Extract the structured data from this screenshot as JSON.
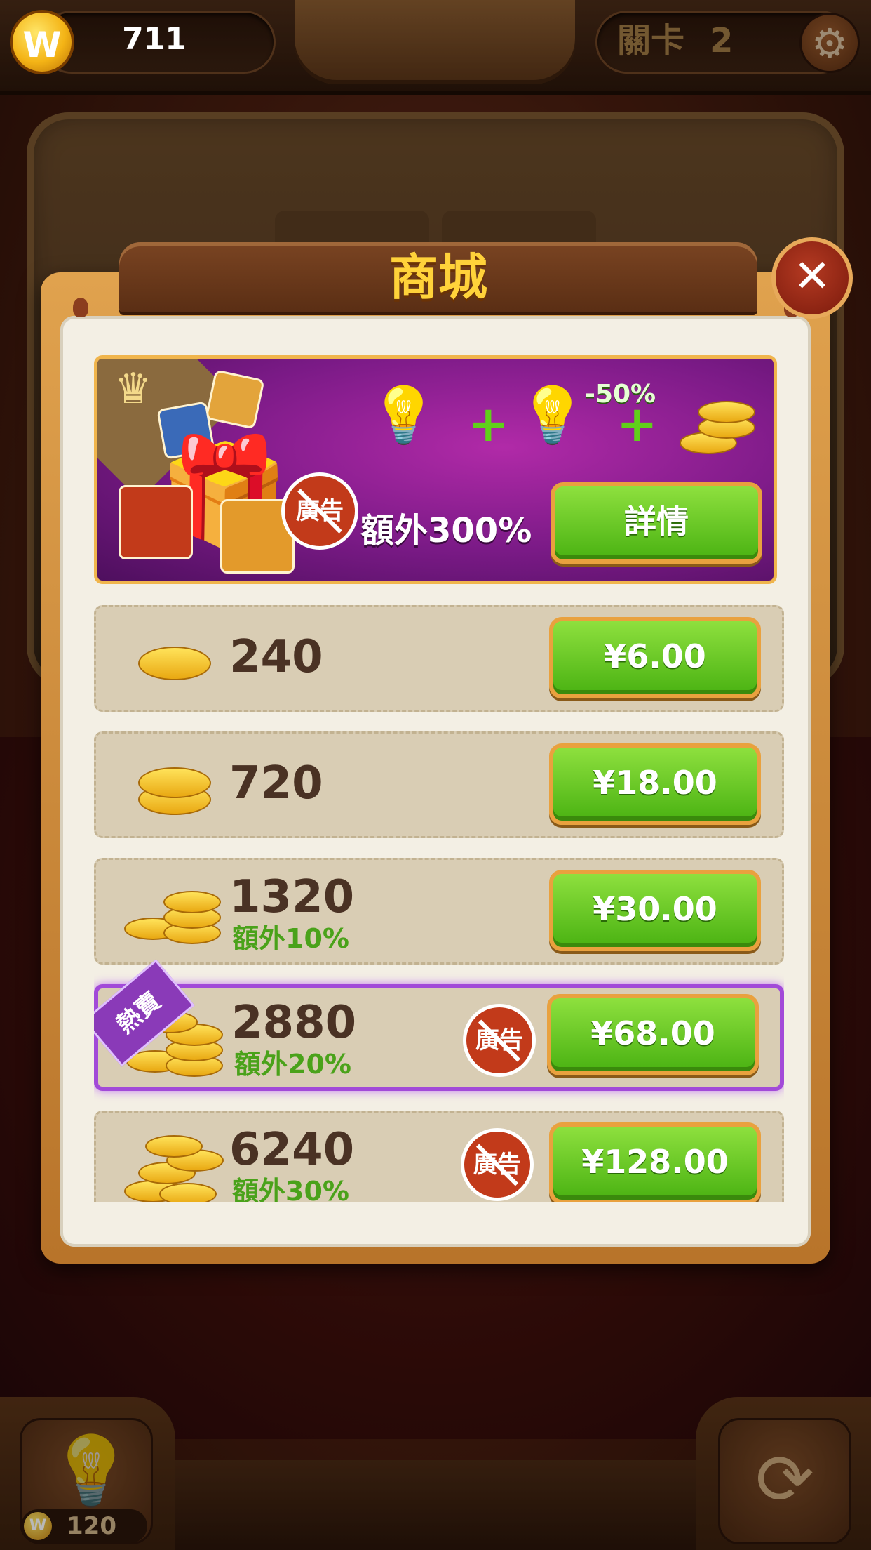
{
  "topbar": {
    "coin_symbol": "W",
    "coins": "711",
    "level_label": "關卡",
    "level_number": "2",
    "settings_icon": "gear-icon"
  },
  "bottom": {
    "hint_icon": "lightbulb-icon",
    "hint_cost": "120",
    "refresh_icon": "refresh-icon"
  },
  "shop": {
    "title": "商城",
    "close_icon": "close-icon",
    "promo": {
      "discount": "-50%",
      "no_ads_label": "廣告",
      "extra": "額外300%",
      "details_button": "詳情"
    },
    "items": [
      {
        "amount": "240",
        "bonus": "",
        "price": "¥6.00",
        "no_ads": false,
        "hot": false
      },
      {
        "amount": "720",
        "bonus": "",
        "price": "¥18.00",
        "no_ads": false,
        "hot": false
      },
      {
        "amount": "1320",
        "bonus": "額外10%",
        "price": "¥30.00",
        "no_ads": false,
        "hot": false
      },
      {
        "amount": "2880",
        "bonus": "額外20%",
        "price": "¥68.00",
        "no_ads": true,
        "hot": true,
        "hot_label": "熱賣"
      },
      {
        "amount": "6240",
        "bonus": "額外30%",
        "price": "¥128.00",
        "no_ads": true,
        "hot": false
      }
    ]
  },
  "colors": {
    "accent_gold": "#ffd23a",
    "buy_green": "#5ac21a",
    "hot_purple": "#a24ad8",
    "bonus_green": "#4aa21a"
  }
}
